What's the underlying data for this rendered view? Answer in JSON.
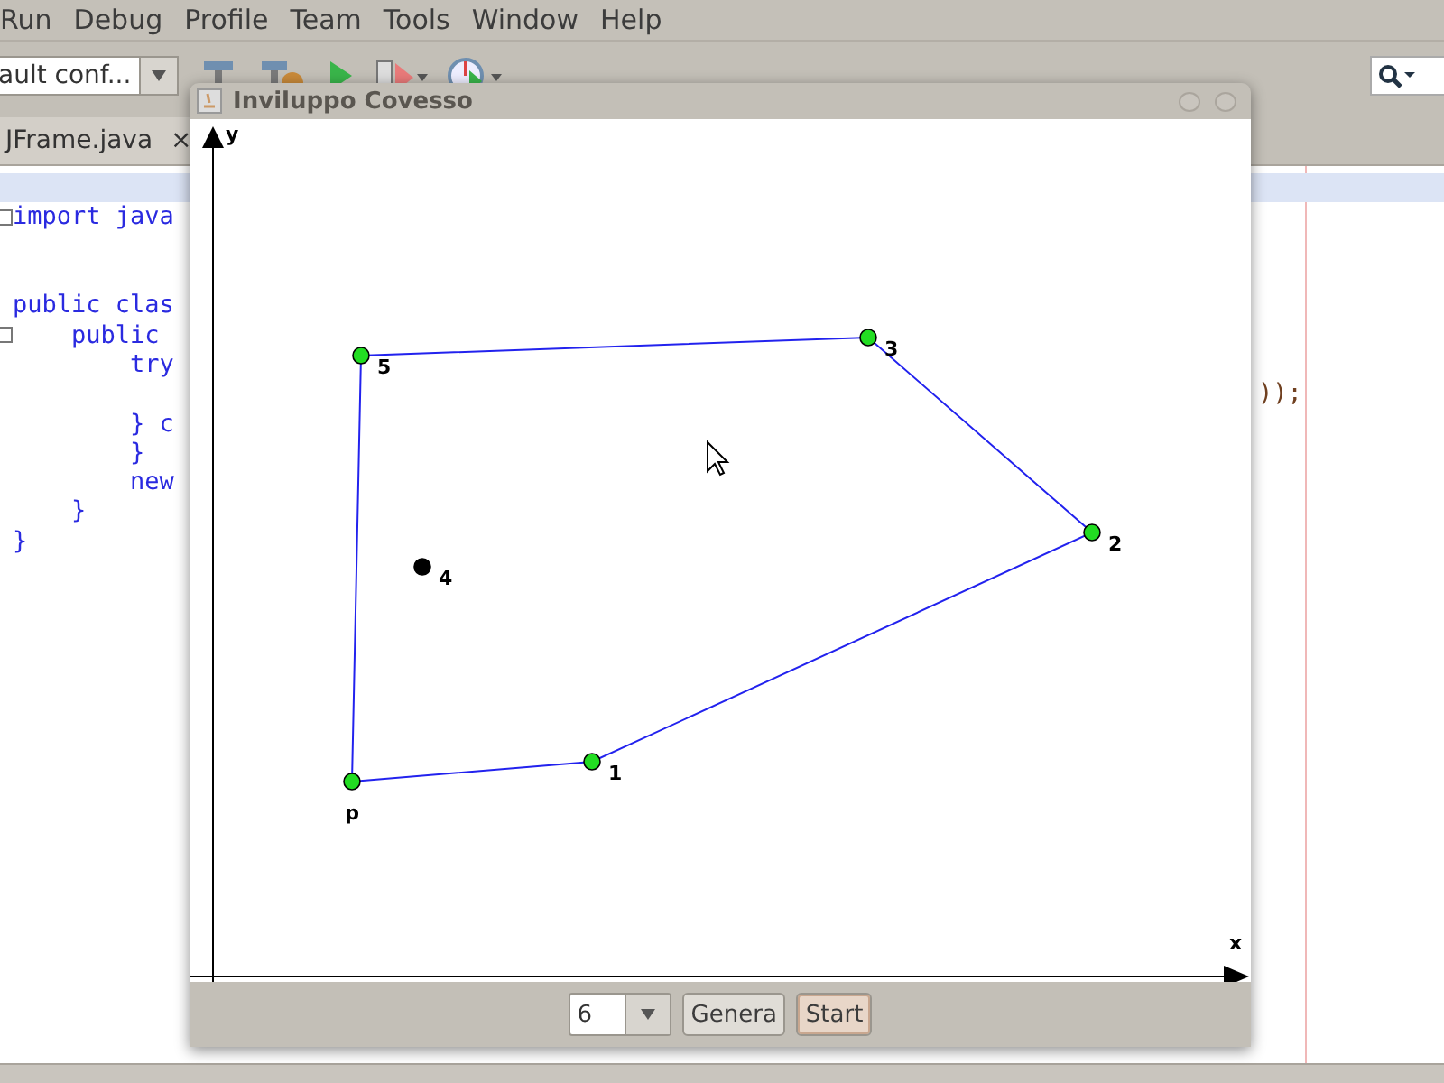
{
  "menu": [
    "Run",
    "Debug",
    "Profile",
    "Team",
    "Tools",
    "Window",
    "Help"
  ],
  "toolbar": {
    "config": "ault conf..."
  },
  "editor_tab": {
    "label": "JFrame.java",
    "close": "×"
  },
  "editor_lines": [
    {
      "current": true
    },
    {
      "left": "import java",
      "fold": true,
      "current": false
    },
    {
      "current": false
    },
    {
      "current": false
    },
    {
      "left": "public clas",
      "current": false
    },
    {
      "left": "    public",
      "fold": true,
      "current": false
    },
    {
      "left": "        try",
      "current": false
    },
    {
      "right": "));",
      "current": false
    },
    {
      "left": "        } c",
      "current": false
    },
    {
      "left": "        }",
      "current": false
    },
    {
      "left": "        new",
      "current": false
    },
    {
      "left": "    }",
      "current": false
    },
    {
      "left": "}",
      "current": false
    }
  ],
  "dialog": {
    "title": "Inviluppo Covesso",
    "canvas": {
      "y_label": "y",
      "x_label": "x",
      "points": [
        {
          "label": "p",
          "on_hull": true
        },
        {
          "label": "1",
          "on_hull": true
        },
        {
          "label": "2",
          "on_hull": true
        },
        {
          "label": "3",
          "on_hull": true
        },
        {
          "label": "4",
          "on_hull": false
        },
        {
          "label": "5",
          "on_hull": true
        }
      ]
    },
    "count_value": "6",
    "buttons": [
      {
        "label": "Genera",
        "focused": false
      },
      {
        "label": "Start",
        "focused": true
      }
    ]
  }
}
